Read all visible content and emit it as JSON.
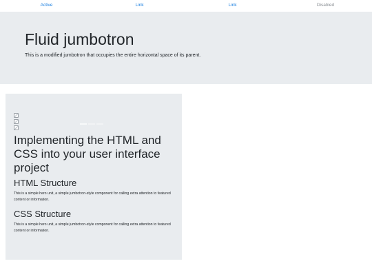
{
  "nav": {
    "items": [
      {
        "label": "Active"
      },
      {
        "label": "Link"
      },
      {
        "label": "Link"
      },
      {
        "label": "Disabled"
      }
    ]
  },
  "jumbotron": {
    "title": "Fluid jumbotron",
    "lead": "This is a modified jumbotron that occupies the entire horizontal space of its parent."
  },
  "card": {
    "carousel": {
      "slide_count": 3,
      "active_slide": 1
    },
    "heading": "Implementing the HTML and CSS into your user interface project",
    "sections": [
      {
        "title": "HTML Structure",
        "text": "This is a simple hero unit, a simple jumbotron-style component for calling extra attention to featured content or information."
      },
      {
        "title": "CSS Structure",
        "text": "This is a simple hero unit, a simple jumbotron-style component for calling extra attention to featured content or information."
      }
    ]
  },
  "colors": {
    "link": "#1a7fe0",
    "disabled": "#8a8f94",
    "panel_bg": "#e9ecef"
  }
}
